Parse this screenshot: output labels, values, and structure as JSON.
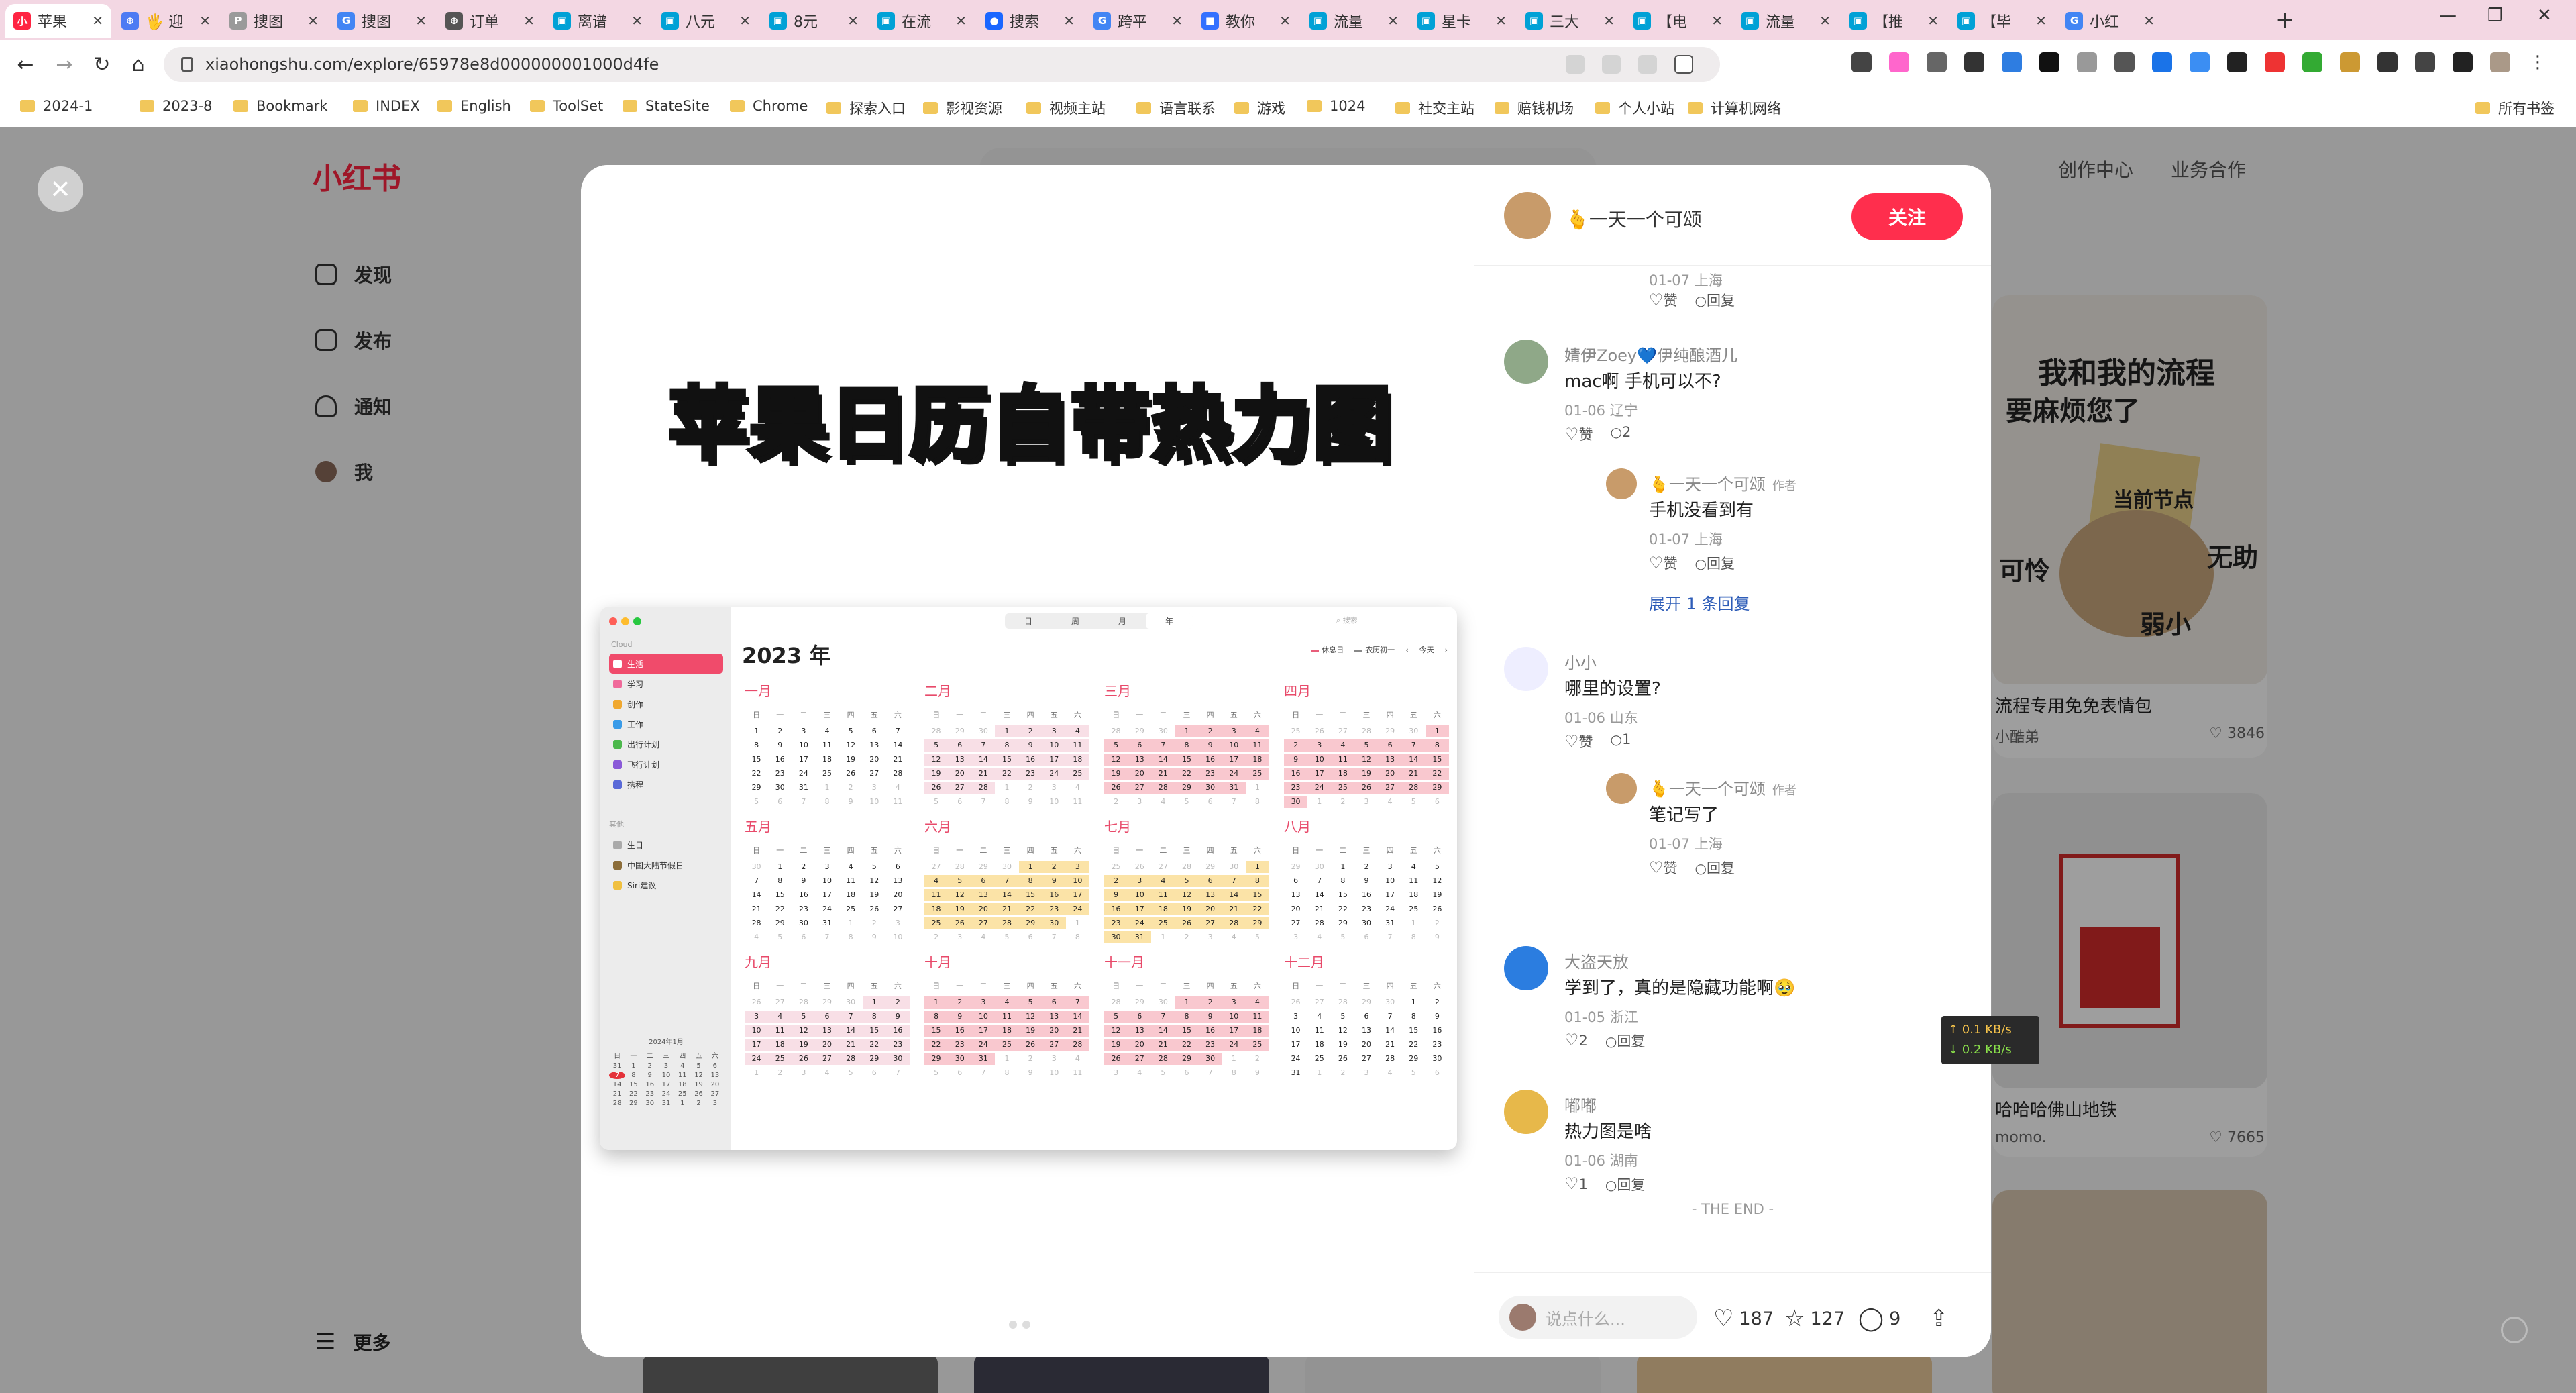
{
  "browser": {
    "tabs": [
      {
        "title": "苹果",
        "color": "#ff2442",
        "glyph": "小",
        "active": true
      },
      {
        "title": "🖐 迎",
        "color": "#4d7bf3",
        "glyph": "⊕"
      },
      {
        "title": "搜图",
        "color": "#9a9a9a",
        "glyph": "P"
      },
      {
        "title": "搜图",
        "color": "#4285f4",
        "glyph": "G"
      },
      {
        "title": "订单",
        "color": "#555555",
        "glyph": "⊕"
      },
      {
        "title": "离谱",
        "color": "#00a1d6",
        "glyph": "▣"
      },
      {
        "title": "八元",
        "color": "#00a1d6",
        "glyph": "▣"
      },
      {
        "title": "8元",
        "color": "#00a1d6",
        "glyph": "▣"
      },
      {
        "title": "在流",
        "color": "#00a1d6",
        "glyph": "▣"
      },
      {
        "title": "搜索",
        "color": "#1a66ff",
        "glyph": "●"
      },
      {
        "title": "跨平",
        "color": "#4285f4",
        "glyph": "G"
      },
      {
        "title": "教你",
        "color": "#3370ff",
        "glyph": "■"
      },
      {
        "title": "流量",
        "color": "#00a1d6",
        "glyph": "▣"
      },
      {
        "title": "星卡",
        "color": "#00a1d6",
        "glyph": "▣"
      },
      {
        "title": "三大",
        "color": "#00a1d6",
        "glyph": "▣"
      },
      {
        "title": "【电",
        "color": "#00a1d6",
        "glyph": "▣"
      },
      {
        "title": "流量",
        "color": "#00a1d6",
        "glyph": "▣"
      },
      {
        "title": "【推",
        "color": "#00a1d6",
        "glyph": "▣"
      },
      {
        "title": "【毕",
        "color": "#00a1d6",
        "glyph": "▣"
      },
      {
        "title": "小红",
        "color": "#4285f4",
        "glyph": "G"
      }
    ],
    "url": "xiaohongshu.com/explore/65978e8d000000001000d4fe",
    "bookmarks": [
      "2024-1",
      "2023-8",
      "Bookmark",
      "INDEX",
      "English",
      "ToolSet",
      "StateSite",
      "Chrome",
      "探索入口",
      "影视资源",
      "视频主站",
      "语言联系",
      "游戏",
      "1024",
      "社交主站",
      "赔钱机场",
      "个人小站",
      "计算机网络"
    ],
    "all_bookmarks": "所有书签"
  },
  "site": {
    "logo": "小红书",
    "nav": [
      "发现",
      "发布",
      "通知",
      "我"
    ],
    "more": "更多",
    "top_links": [
      "创作中心",
      "业务合作"
    ],
    "cards": [
      {
        "caption": "流程专用免免表情包",
        "author": "小酷弟",
        "likes": "3846"
      },
      {
        "caption": "哈哈哈佛山地铁",
        "author": "momo.",
        "likes": "7665"
      }
    ],
    "sticker_text": [
      "我和我的流程",
      "要麻烦您了",
      "可怜",
      "无助",
      "弱小",
      "当前节点"
    ]
  },
  "post": {
    "title": "苹果日历自带热力图",
    "calendar": {
      "year": "2023 年",
      "view_tabs": [
        "日",
        "周",
        "月",
        "年"
      ],
      "active_view": "年",
      "search": "搜索",
      "legend": [
        "休息日",
        "农历初一"
      ],
      "today": "今天",
      "sidebar_header": "iCloud",
      "calendars": [
        "生活",
        "学习",
        "创作",
        "工作",
        "出行计划",
        "飞行计划",
        "携程"
      ],
      "calendar_colors": [
        "#f04b6b",
        "#f06a9a",
        "#f0a830",
        "#3a9be8",
        "#4cb84c",
        "#8a5ad8",
        "#5a6ad8"
      ],
      "other_header": "其他",
      "others": [
        "生日",
        "中国大陆节假日",
        "Siri建议"
      ],
      "mini_month": "2024年1月",
      "mini_days": [
        "31",
        "1",
        "2",
        "3",
        "4",
        "5",
        "6",
        "7",
        "8",
        "9",
        "10",
        "11",
        "12",
        "13",
        "14",
        "15",
        "16",
        "17",
        "18",
        "19",
        "20",
        "21",
        "22",
        "23",
        "24",
        "25",
        "26",
        "27",
        "28",
        "29",
        "30",
        "31",
        "1",
        "2",
        "3"
      ],
      "weekdays": [
        "日",
        "一",
        "二",
        "三",
        "四",
        "五",
        "六"
      ],
      "months": [
        "一月",
        "二月",
        "三月",
        "四月",
        "五月",
        "六月",
        "七月",
        "八月",
        "九月",
        "十月",
        "十一月",
        "十二月"
      ],
      "month_starts": [
        0,
        3,
        3,
        6,
        1,
        4,
        6,
        2,
        5,
        0,
        3,
        5
      ],
      "month_lengths": [
        31,
        28,
        31,
        30,
        31,
        30,
        31,
        31,
        30,
        31,
        30,
        31
      ]
    }
  },
  "author": {
    "name": "🫰一天一个可颂",
    "follow": "关注"
  },
  "comments": [
    {
      "type": "fragment",
      "date": "01-07 上海",
      "like": "赞",
      "reply": "回复"
    },
    {
      "type": "top",
      "name": "婧伊Zoey💙伊纯酿酒儿",
      "text": "mac啊 手机可以不?",
      "date": "01-06 辽宁",
      "like": "赞",
      "reply": "2"
    },
    {
      "type": "reply",
      "name": "🫰一天一个可颂",
      "tag": "作者",
      "text": "手机没看到有",
      "date": "01-07 上海",
      "like": "赞",
      "reply": "回复"
    },
    {
      "type": "expand",
      "text": "展开 1 条回复"
    },
    {
      "type": "top",
      "name": "小小",
      "text": "哪里的设置?",
      "date": "01-06 山东",
      "like": "赞",
      "reply": "1"
    },
    {
      "type": "reply",
      "name": "🫰一天一个可颂",
      "tag": "作者",
      "text": "笔记写了",
      "date": "01-07 上海",
      "like": "赞",
      "reply": "回复"
    },
    {
      "type": "top",
      "name": "大盗天放",
      "text": "学到了，真的是隐藏功能啊🥹",
      "date": "01-05 浙江",
      "like": "2",
      "reply": "回复"
    },
    {
      "type": "top",
      "name": "嘟嘟",
      "text": "热力图是啥",
      "date": "01-06 湖南",
      "like": "1",
      "reply": "回复"
    }
  ],
  "the_end": "- THE END -",
  "bottom": {
    "placeholder": "说点什么...",
    "likes": "187",
    "collects": "127",
    "comments": "9"
  },
  "netspeed": {
    "up": "↑ 0.1 KB/s",
    "down": "↓ 0.2 KB/s"
  }
}
